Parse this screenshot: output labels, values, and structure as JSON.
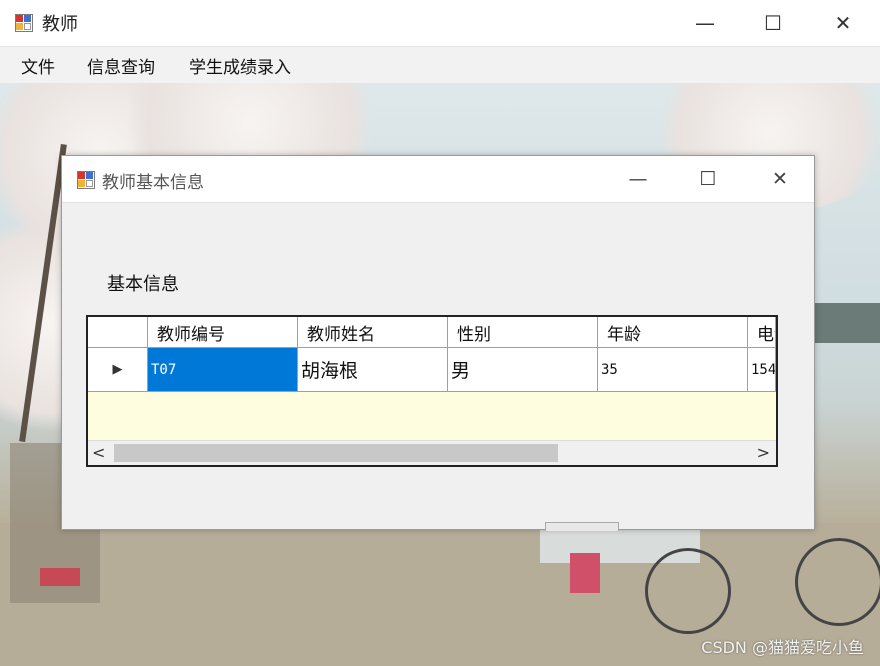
{
  "main_window": {
    "title": "教师",
    "controls": {
      "minimize": "—",
      "maximize": "☐",
      "close": "✕"
    }
  },
  "menu": {
    "items": [
      "文件",
      "信息查询",
      "学生成绩录入"
    ]
  },
  "dialog": {
    "title": "教师基本信息",
    "controls": {
      "minimize": "—",
      "maximize": "☐",
      "close": "✕"
    },
    "section_label": "基本信息",
    "grid": {
      "columns": [
        "教师编号",
        "教师姓名",
        "性别",
        "年龄",
        "电话"
      ],
      "rows": [
        {
          "indicator": "▶",
          "values": [
            "T07",
            "胡海根",
            "男",
            "35",
            "154"
          ]
        }
      ],
      "scroll_left": "<",
      "scroll_right": ">"
    }
  },
  "watermark": "CSDN @猫猫爱吃小鱼",
  "colors": {
    "selection": "#0078d7",
    "grid_background": "#fffde0"
  }
}
